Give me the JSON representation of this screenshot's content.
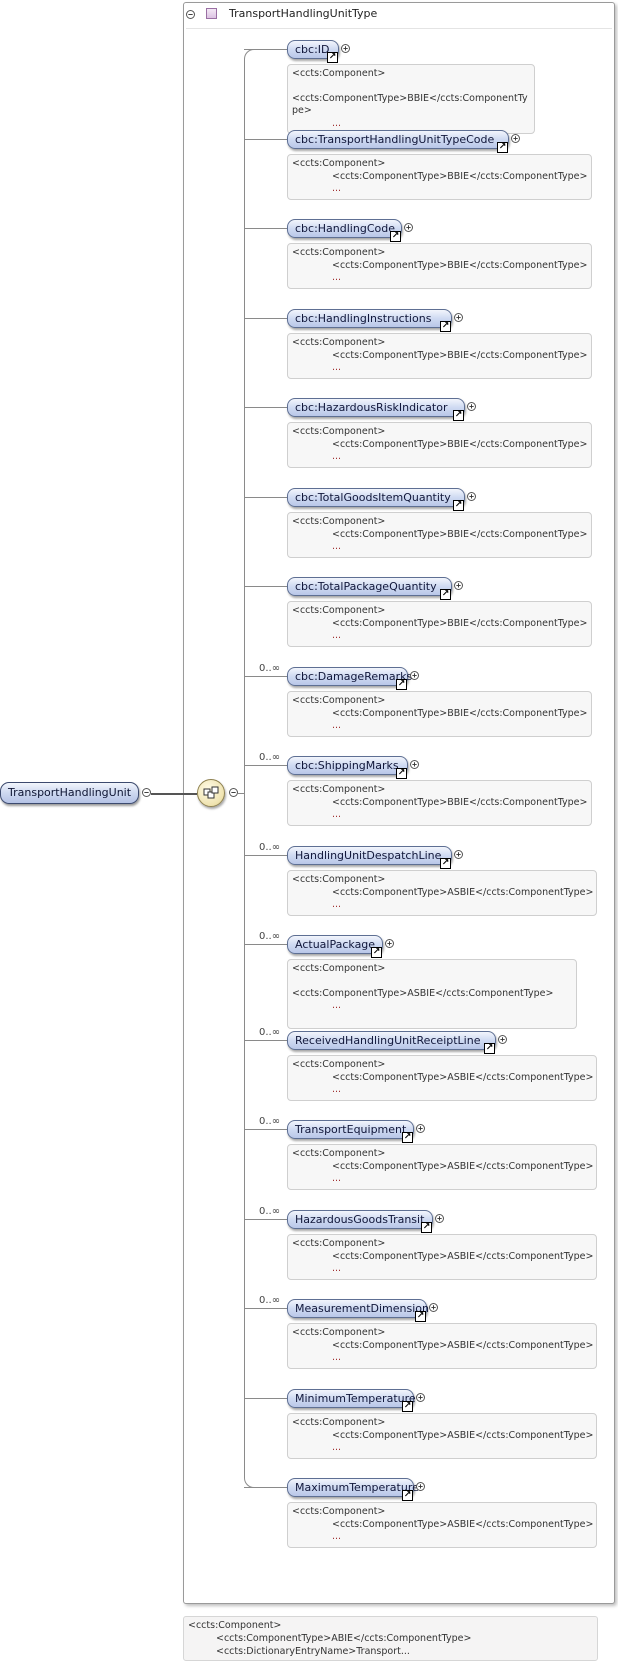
{
  "root": {
    "label": "TransportHandlingUnit"
  },
  "type_box": {
    "title": "TransportHandlingUnitType"
  },
  "annotation_lines": {
    "open": "<ccts:Component>",
    "bbie": "<ccts:ComponentType>BBIE</ccts:ComponentType>",
    "asbie": "<ccts:ComponentType>ASBIE</ccts:ComponentType>",
    "bbie_wrap_1": "<ccts:ComponentType>BBIE</ccts:ComponentTy",
    "bbie_wrap_2": "pe>",
    "ellipsis": "..."
  },
  "elements": [
    {
      "label": "cbc:ID",
      "cardinality": "",
      "kind": "bbie",
      "wrap": true
    },
    {
      "label": "cbc:TransportHandlingUnitTypeCode",
      "cardinality": "",
      "kind": "bbie"
    },
    {
      "label": "cbc:HandlingCode",
      "cardinality": "",
      "kind": "bbie"
    },
    {
      "label": "cbc:HandlingInstructions",
      "cardinality": "",
      "kind": "bbie"
    },
    {
      "label": "cbc:HazardousRiskIndicator",
      "cardinality": "",
      "kind": "bbie"
    },
    {
      "label": "cbc:TotalGoodsItemQuantity",
      "cardinality": "",
      "kind": "bbie"
    },
    {
      "label": "cbc:TotalPackageQuantity",
      "cardinality": "",
      "kind": "bbie"
    },
    {
      "label": "cbc:DamageRemarks",
      "cardinality": "0..∞",
      "kind": "bbie"
    },
    {
      "label": "cbc:ShippingMarks",
      "cardinality": "0..∞",
      "kind": "bbie"
    },
    {
      "label": "HandlingUnitDespatchLine",
      "cardinality": "0..∞",
      "kind": "asbie"
    },
    {
      "label": "ActualPackage",
      "cardinality": "0..∞",
      "kind": "asbie",
      "wrap": true
    },
    {
      "label": "ReceivedHandlingUnitReceiptLine",
      "cardinality": "0..∞",
      "kind": "asbie"
    },
    {
      "label": "TransportEquipment",
      "cardinality": "0..∞",
      "kind": "asbie"
    },
    {
      "label": "HazardousGoodsTransit",
      "cardinality": "0..∞",
      "kind": "asbie"
    },
    {
      "label": "MeasurementDimension",
      "cardinality": "0..∞",
      "kind": "asbie"
    },
    {
      "label": "MinimumTemperature",
      "cardinality": "",
      "kind": "asbie"
    },
    {
      "label": "MaximumTemperature",
      "cardinality": "",
      "kind": "asbie"
    }
  ],
  "bottom_annotation": {
    "line1": "<ccts:Component>",
    "line2": "<ccts:ComponentType>ABIE</ccts:ComponentType>",
    "line3": "<ccts:DictionaryEntryName>Transport..."
  },
  "icons": {
    "expand": "plus-circle-icon",
    "collapse": "minus-circle-icon",
    "link": "arrow-link-icon",
    "sequence": "sequence-compositor-icon",
    "type": "complex-type-icon"
  }
}
